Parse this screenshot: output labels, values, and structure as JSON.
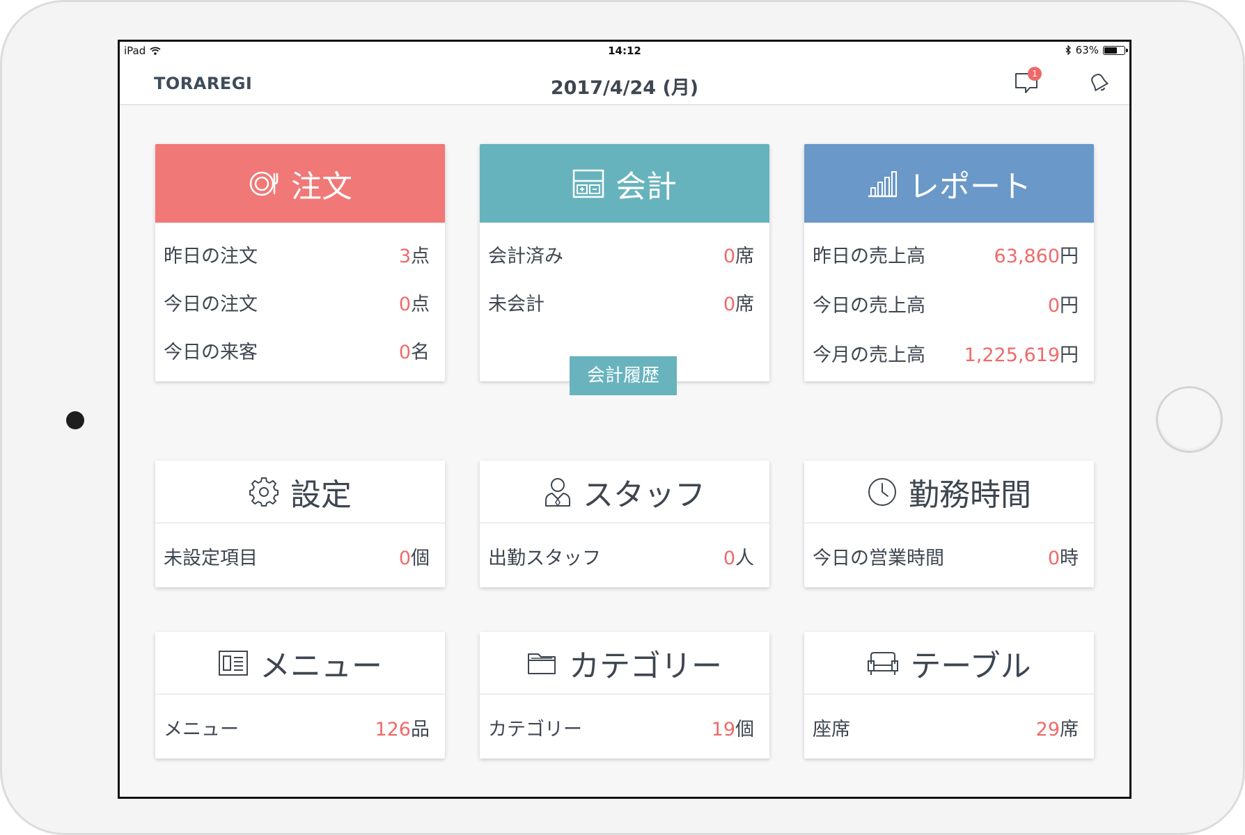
{
  "status_bar": {
    "device": "iPad",
    "time": "14:12",
    "battery": "63%",
    "battery_level": 0.63
  },
  "navbar": {
    "brand": "TORAREGI",
    "date": "2017/4/24 (月)",
    "chat_badge": "1"
  },
  "colors": {
    "order": "#f07876",
    "accounting": "#67b3bd",
    "report": "#6a98c8",
    "highlight": "#ef6a6a"
  },
  "cards": {
    "order": {
      "title": "注文",
      "icon": "plate-icon",
      "rows": [
        {
          "label": "昨日の注文",
          "value": "3",
          "unit": "点"
        },
        {
          "label": "今日の注文",
          "value": "0",
          "unit": "点"
        },
        {
          "label": "今日の来客",
          "value": "0",
          "unit": "名"
        }
      ]
    },
    "accounting": {
      "title": "会計",
      "icon": "register-icon",
      "rows": [
        {
          "label": "会計済み",
          "value": "0",
          "unit": "席"
        },
        {
          "label": "未会計",
          "value": "0",
          "unit": "席"
        }
      ],
      "history_button": "会計履歴"
    },
    "report": {
      "title": "レポート",
      "icon": "bar-chart-icon",
      "rows": [
        {
          "label": "昨日の売上高",
          "value": "63,860",
          "unit": "円"
        },
        {
          "label": "今日の売上高",
          "value": "0",
          "unit": "円"
        },
        {
          "label": "今月の売上高",
          "value": "1,225,619",
          "unit": "円"
        }
      ]
    },
    "settings": {
      "title": "設定",
      "icon": "gear-icon",
      "rows": [
        {
          "label": "未設定項目",
          "value": "0",
          "unit": "個"
        }
      ]
    },
    "staff": {
      "title": "スタッフ",
      "icon": "person-icon",
      "rows": [
        {
          "label": "出勤スタッフ",
          "value": "0",
          "unit": "人"
        }
      ]
    },
    "worktime": {
      "title": "勤務時間",
      "icon": "clock-icon",
      "rows": [
        {
          "label": "今日の営業時間",
          "value": "0",
          "unit": "時"
        }
      ]
    },
    "menu": {
      "title": "メニュー",
      "icon": "menu-book-icon",
      "rows": [
        {
          "label": "メニュー",
          "value": "126",
          "unit": "品"
        }
      ]
    },
    "category": {
      "title": "カテゴリー",
      "icon": "folder-icon",
      "rows": [
        {
          "label": "カテゴリー",
          "value": "19",
          "unit": "個"
        }
      ]
    },
    "table": {
      "title": "テーブル",
      "icon": "sofa-icon",
      "rows": [
        {
          "label": "座席",
          "value": "29",
          "unit": "席"
        }
      ]
    }
  }
}
